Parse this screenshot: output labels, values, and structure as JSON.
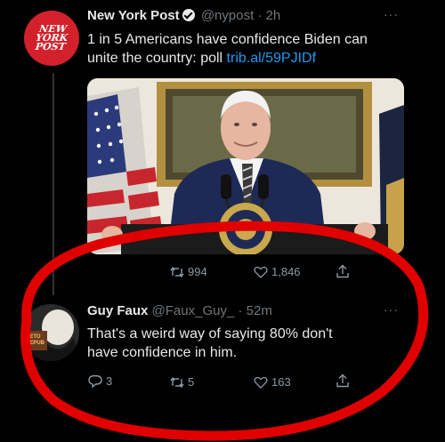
{
  "tweet": {
    "logo_lines": [
      "NEW",
      "YORK",
      "POST"
    ],
    "author_name": "New York Post",
    "handle": "@nypost",
    "time": "2h",
    "more": "···",
    "text": "1 in 5 Americans have confidence Biden can unite the country: poll",
    "link": "trib.al/59PJIDf",
    "retweets": "994",
    "likes": "1,846"
  },
  "reply": {
    "author_name": "Guy Faux",
    "handle": "@Faux_Guy_",
    "time": "52m",
    "more": "···",
    "text_line1": "That's a weird way of saying 80% don't",
    "text_line2": "have confidence in him.",
    "replies": "3",
    "retweets": "5",
    "likes": "163",
    "avatar_text": "RETO\nREPUB"
  },
  "colors": {
    "background": "#000000",
    "text": "#e7e9ea",
    "muted": "#71767b",
    "link": "#1d9bf0",
    "annotation": "#e00000"
  },
  "icons": [
    "verified-badge-icon",
    "retweet-icon",
    "heart-icon",
    "share-icon",
    "reply-icon",
    "more-icon"
  ]
}
